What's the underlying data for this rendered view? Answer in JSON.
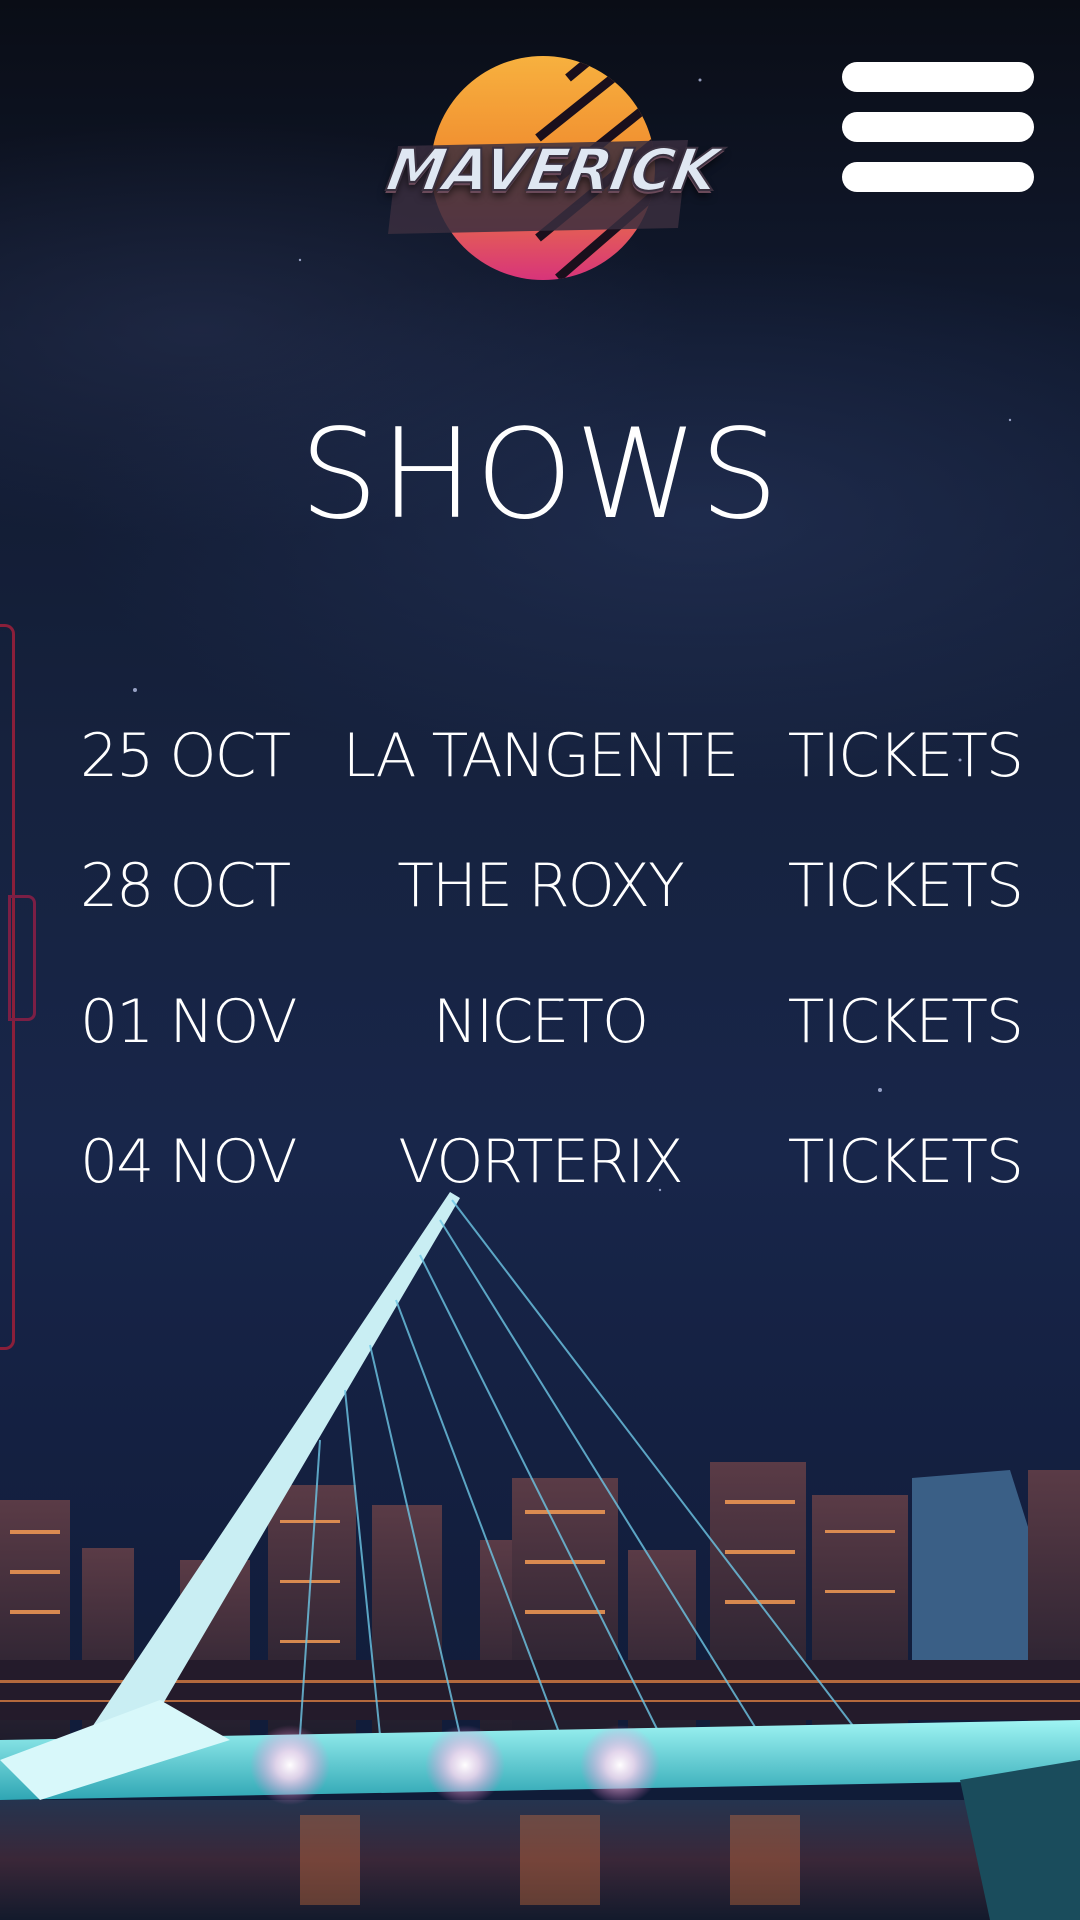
{
  "brand": {
    "logo_text": "MAVERICK"
  },
  "header": {
    "menu_icon": "hamburger-menu-icon"
  },
  "page": {
    "title": "SHOWS"
  },
  "shows": [
    {
      "date": "25 OCT",
      "venue": "LA TANGENTE",
      "cta": "TICKETS"
    },
    {
      "date": "28 OCT",
      "venue": "THE ROXY",
      "cta": "TICKETS"
    },
    {
      "date": "01 NOV",
      "venue": "NICETO",
      "cta": "TICKETS"
    },
    {
      "date": "04 NOV",
      "venue": "VORTERIX",
      "cta": "TICKETS"
    }
  ],
  "colors": {
    "text": "#ffffff",
    "background_sky": "#16223e",
    "logo_orange": "#f5a33b",
    "logo_pink": "#d8347a",
    "bridge_cyan": "#43e0e6",
    "city_lights": "#e8703a"
  }
}
